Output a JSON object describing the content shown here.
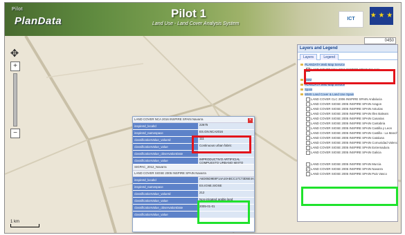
{
  "header": {
    "logo_top": "Pilot",
    "logo": "PlanData",
    "title": "Pilot 1",
    "subtitle": "Land Use - Land Cover Analysis System",
    "ict_badge": "ICT",
    "eu_flag": "★ ★ ★"
  },
  "map": {
    "coords": "0450",
    "scale_label": "1 km"
  },
  "layers_panel": {
    "title": "Layers and Legend",
    "tabs": [
      "Layers",
      "Legend"
    ],
    "top_group": [
      {
        "label": "PLANDATA Web Map Service",
        "type": "service"
      },
      {
        "label": "LAND COVER NCA 2016 INSPIRE SPAIN Navarra",
        "type": "layer",
        "checked": true
      }
    ],
    "mid_group": [
      {
        "label": "OSM",
        "type": "service"
      },
      {
        "label": "PLANDATA Web Map Service",
        "type": "service"
      },
      {
        "label": "Spain",
        "type": "service"
      },
      {
        "label": "WMS Land Cover & Land Use Spain",
        "type": "service"
      },
      {
        "label": "LAND COVER CLC 2006 INSPIRE SPAIN Andalucia",
        "type": "layer"
      },
      {
        "label": "LAND COVER SIOSE 2005 INSPIRE SPAIN Aragon",
        "type": "layer"
      },
      {
        "label": "LAND COVER SIOSE 2005 INSPIRE SPAIN Asturias",
        "type": "layer"
      },
      {
        "label": "LAND COVER SIOSE 2005 INSPIRE SPAIN Illes Balears",
        "type": "layer"
      },
      {
        "label": "LAND COVER SIOSE 2005 INSPIRE SPAIN Canarias",
        "type": "layer"
      },
      {
        "label": "LAND COVER SIOSE 2005 INSPIRE SPAIN Cantabria",
        "type": "layer"
      },
      {
        "label": "LAND COVER SIOSE 2005 INSPIRE SPAIN Castilla y Leon",
        "type": "layer"
      },
      {
        "label": "LAND COVER SIOSE 2005 INSPIRE SPAIN Castilla - La Mancha",
        "type": "layer"
      },
      {
        "label": "LAND COVER SIOSE 2005 INSPIRE SPAIN Cataluna",
        "type": "layer"
      },
      {
        "label": "LAND COVER SIOSE 2005 INSPIRE SPAIN Comunidad Valenciana",
        "type": "layer"
      },
      {
        "label": "LAND COVER SIOSE 2005 INSPIRE SPAIN Extremadura",
        "type": "layer"
      },
      {
        "label": "LAND COVER SIOSE 2005 INSPIRE SPAIN Galicia",
        "type": "layer"
      }
    ],
    "bottom_group": [
      {
        "label": "LAND COVER SIOSE 2005 INSPIRE SPAIN Murcia",
        "type": "layer"
      },
      {
        "label": "LAND COVER SIOSE 2005 INSPIRE SPAIN Navarra",
        "type": "layer",
        "checked": true
      },
      {
        "label": "LAND COVER SIOSE 2005 INSPIRE SPAIN Pais Vasco",
        "type": "layer"
      }
    ]
  },
  "popup": {
    "section1": "LAND COVER NCA 2016 INSPIRE SPAIN Navarra",
    "rows1": [
      {
        "key": "inspireId_localId",
        "value": "22675"
      },
      {
        "key": "inspireId_namespace",
        "value": "ES.GN.NCA2016"
      },
      {
        "key": "classificationValue_valueId",
        "value": "111"
      },
      {
        "key": "classificationValue_value",
        "value": "Continuous urban fabric"
      },
      {
        "key": "classificationValue_observationDate",
        "value": "2016-01-01"
      },
      {
        "key": "classificationValue_value",
        "value": "IMPRODUCTIVO ARTIFICIAL COMPUESTO URBANO MIXTO ENSANCHE"
      }
    ],
    "section_mid": "SIGPAC_2012_Navarra",
    "section2": "LAND COVER SIOSE 2005 INSPIRE SPAIN Navarra",
    "rows2": [
      {
        "key": "inspireId_localId",
        "value": "A5D05D9E8F14A10ABCC17C73D5E4A3"
      },
      {
        "key": "inspireId_namespace",
        "value": "ES.IGNE.SIOSE"
      },
      {
        "key": "classificationValue_valueId",
        "value": "212"
      },
      {
        "key": "classificationValue_value",
        "value": "Non-irrigated arable land"
      },
      {
        "key": "classificationValue_observationDate",
        "value": "2005-01-01"
      },
      {
        "key": "classificationValue_value",
        "value": ""
      }
    ],
    "close_label": "×"
  }
}
